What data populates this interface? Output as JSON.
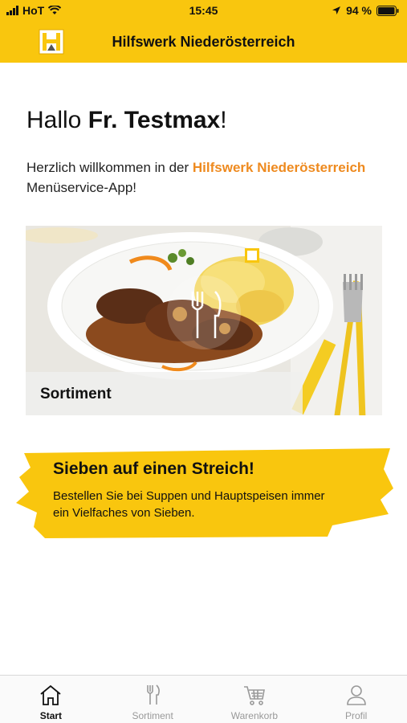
{
  "status": {
    "carrier": "HoT",
    "time": "15:45",
    "battery": "94 %"
  },
  "appbar": {
    "title": "Hilfswerk Niederösterreich"
  },
  "greeting": {
    "hello": "Hallo",
    "name": "Fr. Testmax",
    "punct": "!"
  },
  "welcome": {
    "prefix": "Herzlich willkommen in der ",
    "brand": "Hilfswerk Niederösterreich",
    "suffix": " Menüservice-App!"
  },
  "card": {
    "label": "Sortiment"
  },
  "promo": {
    "title": "Sieben auf einen Streich!",
    "text": "Bestellen Sie bei Suppen und Hauptspeisen immer ein Vielfaches von Sieben."
  },
  "tabs": [
    {
      "label": "Start",
      "icon": "home-icon",
      "active": true
    },
    {
      "label": "Sortiment",
      "icon": "cutlery-icon",
      "active": false
    },
    {
      "label": "Warenkorb",
      "icon": "cart-icon",
      "active": false
    },
    {
      "label": "Profil",
      "icon": "person-icon",
      "active": false
    }
  ],
  "colors": {
    "brand_yellow": "#f9c60e",
    "accent_orange": "#ee8a1f"
  }
}
